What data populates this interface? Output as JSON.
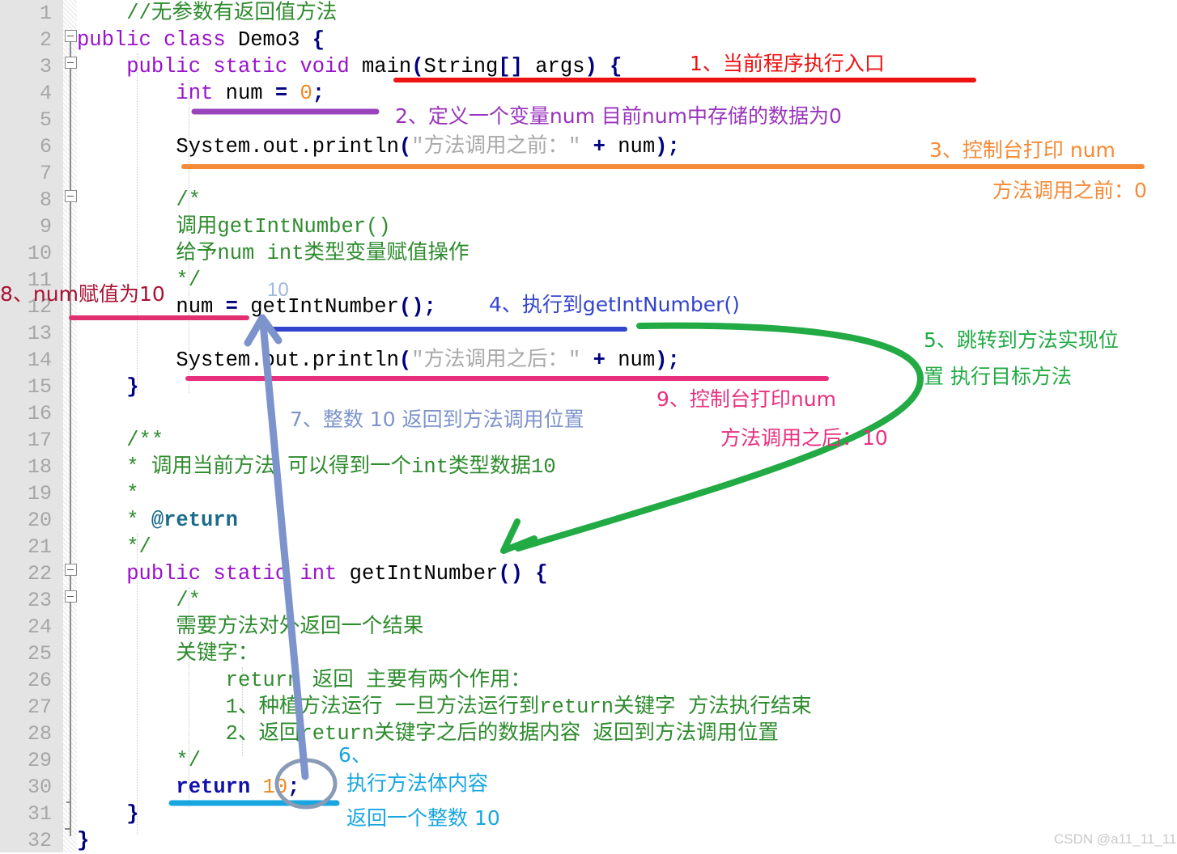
{
  "editor": {
    "watermark": "CSDN @a11_11_11",
    "line_numbers": [
      1,
      2,
      3,
      4,
      5,
      6,
      7,
      8,
      9,
      10,
      11,
      12,
      13,
      14,
      15,
      16,
      17,
      18,
      19,
      20,
      21,
      22,
      23,
      24,
      25,
      26,
      27,
      28,
      29,
      30,
      31,
      32
    ],
    "inline_hint": "10",
    "code_lines": [
      {
        "n": 1,
        "segments": [
          {
            "t": "    ",
            "c": "pl"
          },
          {
            "t": "//无参数有返回值方法",
            "c": "cm"
          }
        ]
      },
      {
        "n": 2,
        "segments": [
          {
            "t": "public class ",
            "c": "kw"
          },
          {
            "t": "Demo3 ",
            "c": "pl"
          },
          {
            "t": "{",
            "c": "pnct"
          }
        ]
      },
      {
        "n": 3,
        "segments": [
          {
            "t": "    ",
            "c": "pl"
          },
          {
            "t": "public static void ",
            "c": "kw"
          },
          {
            "t": "main",
            "c": "pl"
          },
          {
            "t": "(",
            "c": "pnct"
          },
          {
            "t": "String",
            "c": "pl"
          },
          {
            "t": "[]",
            "c": "pnct"
          },
          {
            "t": " args",
            "c": "pl"
          },
          {
            "t": ")",
            "c": "pnct"
          },
          {
            "t": " ",
            "c": "pl"
          },
          {
            "t": "{",
            "c": "pnct"
          }
        ]
      },
      {
        "n": 4,
        "segments": [
          {
            "t": "        ",
            "c": "pl"
          },
          {
            "t": "int ",
            "c": "kw"
          },
          {
            "t": "num ",
            "c": "pl"
          },
          {
            "t": "=",
            "c": "op"
          },
          {
            "t": " ",
            "c": "pl"
          },
          {
            "t": "0",
            "c": "num"
          },
          {
            "t": ";",
            "c": "pnct"
          }
        ]
      },
      {
        "n": 5,
        "segments": []
      },
      {
        "n": 6,
        "segments": [
          {
            "t": "        ",
            "c": "pl"
          },
          {
            "t": "System.out.println",
            "c": "pl"
          },
          {
            "t": "(",
            "c": "pnct"
          },
          {
            "t": "\"方法调用之前：\"",
            "c": "str"
          },
          {
            "t": " ",
            "c": "pl"
          },
          {
            "t": "+",
            "c": "op"
          },
          {
            "t": " num",
            "c": "pl"
          },
          {
            "t": ")",
            "c": "pnct"
          },
          {
            "t": ";",
            "c": "pnct"
          }
        ]
      },
      {
        "n": 7,
        "segments": []
      },
      {
        "n": 8,
        "segments": [
          {
            "t": "        ",
            "c": "pl"
          },
          {
            "t": "/*",
            "c": "cm"
          }
        ]
      },
      {
        "n": 9,
        "segments": [
          {
            "t": "        ",
            "c": "pl"
          },
          {
            "t": "调用getIntNumber()",
            "c": "cm"
          }
        ]
      },
      {
        "n": 10,
        "segments": [
          {
            "t": "        ",
            "c": "pl"
          },
          {
            "t": "给予num int类型变量赋值操作",
            "c": "cm"
          }
        ]
      },
      {
        "n": 11,
        "segments": [
          {
            "t": "        ",
            "c": "pl"
          },
          {
            "t": "*/",
            "c": "cm"
          }
        ]
      },
      {
        "n": 12,
        "segments": [
          {
            "t": "        ",
            "c": "pl"
          },
          {
            "t": "num ",
            "c": "pl"
          },
          {
            "t": "=",
            "c": "op"
          },
          {
            "t": " getIntNumber",
            "c": "pl"
          },
          {
            "t": "()",
            "c": "pnct"
          },
          {
            "t": ";",
            "c": "pnct"
          }
        ]
      },
      {
        "n": 13,
        "segments": []
      },
      {
        "n": 14,
        "segments": [
          {
            "t": "        ",
            "c": "pl"
          },
          {
            "t": "System.out.println",
            "c": "pl"
          },
          {
            "t": "(",
            "c": "pnct"
          },
          {
            "t": "\"方法调用之后：\"",
            "c": "str"
          },
          {
            "t": " ",
            "c": "pl"
          },
          {
            "t": "+",
            "c": "op"
          },
          {
            "t": " num",
            "c": "pl"
          },
          {
            "t": ")",
            "c": "pnct"
          },
          {
            "t": ";",
            "c": "pnct"
          }
        ]
      },
      {
        "n": 15,
        "segments": [
          {
            "t": "    ",
            "c": "pl"
          },
          {
            "t": "}",
            "c": "pnct"
          }
        ]
      },
      {
        "n": 16,
        "segments": []
      },
      {
        "n": 17,
        "segments": [
          {
            "t": "    ",
            "c": "pl"
          },
          {
            "t": "/**",
            "c": "cm"
          }
        ]
      },
      {
        "n": 18,
        "segments": [
          {
            "t": "    ",
            "c": "pl"
          },
          {
            "t": "* 调用当前方法 可以得到一个int类型数据10",
            "c": "cm"
          }
        ]
      },
      {
        "n": 19,
        "segments": [
          {
            "t": "    ",
            "c": "pl"
          },
          {
            "t": "*",
            "c": "cm"
          }
        ]
      },
      {
        "n": 20,
        "segments": [
          {
            "t": "    ",
            "c": "pl"
          },
          {
            "t": "* ",
            "c": "cm"
          },
          {
            "t": "@return",
            "c": "cm-tag"
          }
        ]
      },
      {
        "n": 21,
        "segments": [
          {
            "t": "    ",
            "c": "pl"
          },
          {
            "t": "*/",
            "c": "cm"
          }
        ]
      },
      {
        "n": 22,
        "segments": [
          {
            "t": "    ",
            "c": "pl"
          },
          {
            "t": "public static int ",
            "c": "kw"
          },
          {
            "t": "getIntNumber",
            "c": "pl"
          },
          {
            "t": "()",
            "c": "pnct"
          },
          {
            "t": " ",
            "c": "pl"
          },
          {
            "t": "{",
            "c": "pnct"
          }
        ]
      },
      {
        "n": 23,
        "segments": [
          {
            "t": "        ",
            "c": "pl"
          },
          {
            "t": "/*",
            "c": "cm"
          }
        ]
      },
      {
        "n": 24,
        "segments": [
          {
            "t": "        ",
            "c": "pl"
          },
          {
            "t": "需要方法对外返回一个结果",
            "c": "cm"
          }
        ]
      },
      {
        "n": 25,
        "segments": [
          {
            "t": "        ",
            "c": "pl"
          },
          {
            "t": "关键字：",
            "c": "cm"
          }
        ]
      },
      {
        "n": 26,
        "segments": [
          {
            "t": "            ",
            "c": "pl"
          },
          {
            "t": "return 返回 主要有两个作用：",
            "c": "cm"
          }
        ]
      },
      {
        "n": 27,
        "segments": [
          {
            "t": "            ",
            "c": "pl"
          },
          {
            "t": "1、种植方法运行 一旦方法运行到return关键字 方法执行结束",
            "c": "cm"
          }
        ]
      },
      {
        "n": 28,
        "segments": [
          {
            "t": "            ",
            "c": "pl"
          },
          {
            "t": "2、返回return关键字之后的数据内容 返回到方法调用位置",
            "c": "cm"
          }
        ]
      },
      {
        "n": 29,
        "segments": [
          {
            "t": "        ",
            "c": "pl"
          },
          {
            "t": "*/",
            "c": "cm"
          }
        ]
      },
      {
        "n": 30,
        "segments": [
          {
            "t": "        ",
            "c": "pl"
          },
          {
            "t": "return ",
            "c": "kw-b"
          },
          {
            "t": "10",
            "c": "num"
          },
          {
            "t": ";",
            "c": "pnct"
          }
        ]
      },
      {
        "n": 31,
        "segments": [
          {
            "t": "    ",
            "c": "pl"
          },
          {
            "t": "}",
            "c": "pnct"
          }
        ]
      },
      {
        "n": 32,
        "segments": [
          {
            "t": "}",
            "c": "pnct"
          }
        ]
      }
    ]
  },
  "annotations": {
    "step1": {
      "text": "1、当前程序执行入口",
      "color": "#ee1111"
    },
    "step2": {
      "text": "2、定义一个变量num 目前num中存储的数据为0",
      "color": "#9933bb"
    },
    "step3": {
      "text": "3、控制台打印 num",
      "color": "#f58a36"
    },
    "step3_out": {
      "text": "方法调用之前：0",
      "color": "#f58a36"
    },
    "step4": {
      "text": "4、执行到getIntNumber()",
      "color": "#3344cc"
    },
    "step5_l1": {
      "text": "5、跳转到方法实现位",
      "color": "#22aa44"
    },
    "step5_l2": {
      "text": "置 执行目标方法",
      "color": "#22aa44"
    },
    "step6_l1": {
      "text": "6、",
      "color": "#18a6e0"
    },
    "step6_l2": {
      "text": "执行方法体内容",
      "color": "#18a6e0"
    },
    "step6_l3": {
      "text": "返回一个整数 10",
      "color": "#18a6e0"
    },
    "step7": {
      "text": "7、整数 10 返回到方法调用位置",
      "color": "#7d93cc"
    },
    "step8": {
      "text": "8、num赋值为10",
      "color": "#aa1133"
    },
    "step9": {
      "text": "9、控制台打印num",
      "color": "#e8307f"
    },
    "step9_out": {
      "text": "方法调用之后：10",
      "color": "#e8307f"
    }
  },
  "colors": {
    "underline_red": "#ee1111",
    "underline_purple": "#9944bb",
    "underline_orange": "#f58a36",
    "underline_blue": "#3344cc",
    "underline_pink": "#e8307f",
    "underline_crimson": "#e03070",
    "underline_cyan": "#18a6e0",
    "arrow_green": "#22aa44",
    "arrow_steel": "#7d93cc",
    "circle_gray": "#8a9bb5",
    "gutter_bg": "#e4e4e4",
    "linenum": "#a6a6a6"
  }
}
